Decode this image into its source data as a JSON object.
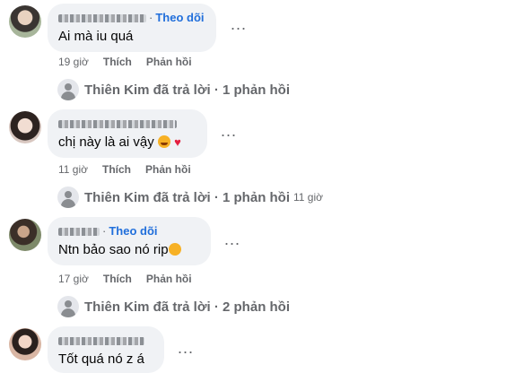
{
  "comments": [
    {
      "follow": "Theo dõi",
      "text": "Ai mà iu quá",
      "time": "19 giờ",
      "like": "Thích",
      "reply": "Phản hồi",
      "replies_summary": "Thiên Kim đã trả lời · 1 phản hồi",
      "replies_time": ""
    },
    {
      "follow": "",
      "text": "chị này là ai vậy",
      "time": "11 giờ",
      "like": "Thích",
      "reply": "Phản hồi",
      "replies_summary": "Thiên Kim đã trả lời · 1 phản hồi",
      "replies_time": "11 giờ"
    },
    {
      "follow": "Theo dõi",
      "text": "Ntn bảo sao nó rip",
      "time": "17 giờ",
      "like": "Thích",
      "reply": "Phản hồi",
      "replies_summary": "Thiên Kim đã trả lời · 2 phản hồi",
      "replies_time": ""
    },
    {
      "follow": "",
      "text": "Tốt quá nó z á"
    }
  ],
  "more_label": "...",
  "colors": {
    "bubble": "#f0f2f5",
    "muted": "#65676b",
    "link": "#216fdb"
  }
}
